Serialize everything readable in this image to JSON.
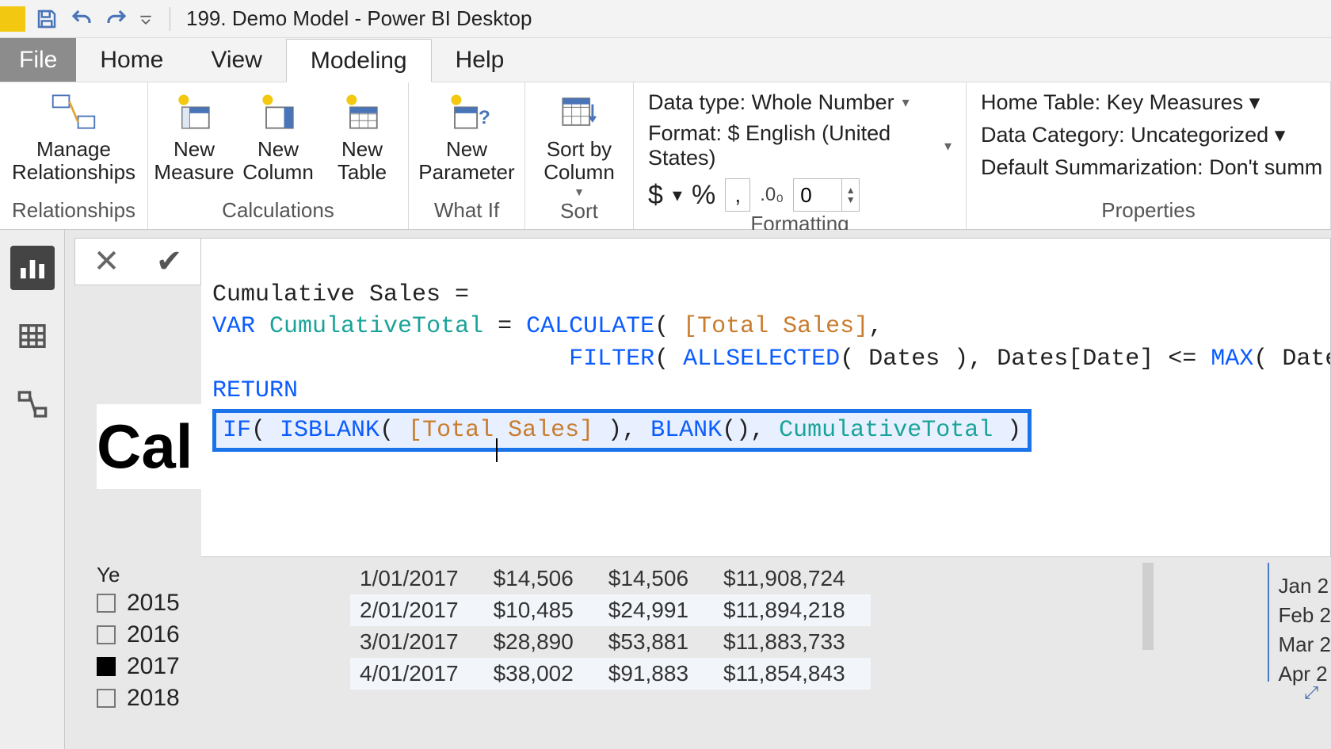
{
  "titlebar": {
    "title": "199. Demo Model - Power BI Desktop"
  },
  "tabs": {
    "file": "File",
    "items": [
      "Home",
      "View",
      "Modeling",
      "Help"
    ],
    "active_index": 2
  },
  "ribbon": {
    "relationships": {
      "manage": "Manage\nRelationships",
      "group": "Relationships"
    },
    "calculations": {
      "new_measure": "New\nMeasure",
      "new_column": "New\nColumn",
      "new_table": "New\nTable",
      "group": "Calculations"
    },
    "whatif": {
      "new_parameter": "New\nParameter",
      "group": "What If"
    },
    "sort": {
      "sort_by": "Sort by\nColumn",
      "group": "Sort"
    },
    "formatting": {
      "datatype_label": "Data type: Whole Number",
      "format_label": "Format: $ English (United States)",
      "decimal_value": "0",
      "group": "Formatting"
    },
    "properties": {
      "home_table": "Home Table: Key Measures",
      "data_category": "Data Category: Uncategorized",
      "default_summ": "Default Summarization: Don't summ",
      "group": "Properties"
    }
  },
  "formula": {
    "line1": "Cumulative Sales =",
    "var_kw": "VAR",
    "var_name": "CumulativeTotal",
    "eq": " = ",
    "calc": "CALCULATE",
    "total_sales": "[Total Sales]",
    "filter": "FILTER",
    "allsel": "ALLSELECTED",
    "dates_tbl": "Dates",
    "dates_col": "Dates[Date]",
    "max": "MAX",
    "return_kw": "RETURN",
    "if_kw": "IF",
    "isblank": "ISBLANK",
    "blank_fn": "BLANK",
    "cum_var": "CumulativeTotal"
  },
  "page_title_fragment": "Cal",
  "slicer": {
    "header": "Ye",
    "years": [
      {
        "label": "2015",
        "checked": false
      },
      {
        "label": "2016",
        "checked": false
      },
      {
        "label": "2017",
        "checked": true
      },
      {
        "label": "2018",
        "checked": false
      }
    ]
  },
  "table_rows": [
    {
      "date": "1/01/2017",
      "a": "$14,506",
      "b": "$14,506",
      "c": "$11,908,724"
    },
    {
      "date": "2/01/2017",
      "a": "$10,485",
      "b": "$24,991",
      "c": "$11,894,218"
    },
    {
      "date": "3/01/2017",
      "a": "$28,890",
      "b": "$53,881",
      "c": "$11,883,733"
    },
    {
      "date": "4/01/2017",
      "a": "$38,002",
      "b": "$91,883",
      "c": "$11,854,843"
    }
  ],
  "months_fragment": [
    "Jan 2",
    "Feb 2",
    "Mar 2",
    "Apr 2"
  ]
}
